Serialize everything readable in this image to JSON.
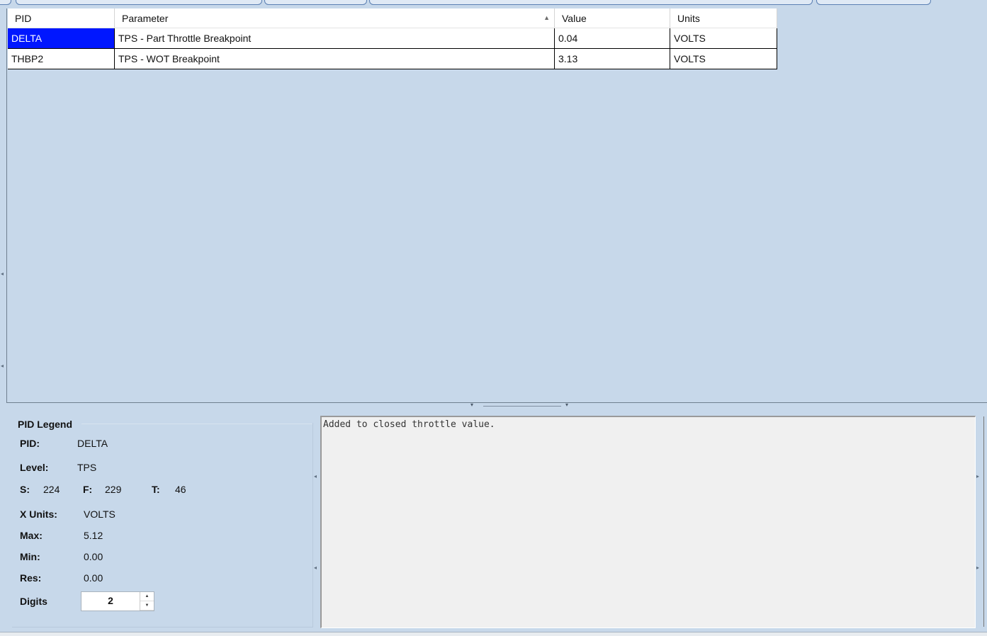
{
  "table": {
    "columns": [
      "PID",
      "Parameter",
      "Value",
      "Units"
    ],
    "rows": [
      {
        "pid": "DELTA",
        "parameter": "TPS - Part Throttle Breakpoint",
        "value": "0.04",
        "units": "VOLTS",
        "selected": true
      },
      {
        "pid": "THBP2",
        "parameter": "TPS - WOT Breakpoint",
        "value": "3.13",
        "units": "VOLTS",
        "selected": false
      }
    ],
    "sort_column": "Parameter",
    "selection_color": "#0017ff"
  },
  "legend": {
    "title": "PID Legend",
    "pid_label": "PID:",
    "pid_value": "DELTA",
    "level_label": "Level:",
    "level_value": "TPS",
    "s_label": "S:",
    "s_value": "224",
    "f_label": "F:",
    "f_value": "229",
    "t_label": "T:",
    "t_value": "46",
    "xunits_label": "X Units:",
    "xunits_value": "VOLTS",
    "max_label": "Max:",
    "max_value": "5.12",
    "min_label": "Min:",
    "min_value": "0.00",
    "res_label": "Res:",
    "res_value": "0.00",
    "digits_label": "Digits",
    "digits_value": "2"
  },
  "description": {
    "text": "Added to closed throttle value."
  },
  "icons": {
    "sort": "sort-ascending-icon",
    "spin_up": "spin-up-icon",
    "spin_down": "spin-down-icon",
    "splitter": "splitter-arrows-icon"
  }
}
